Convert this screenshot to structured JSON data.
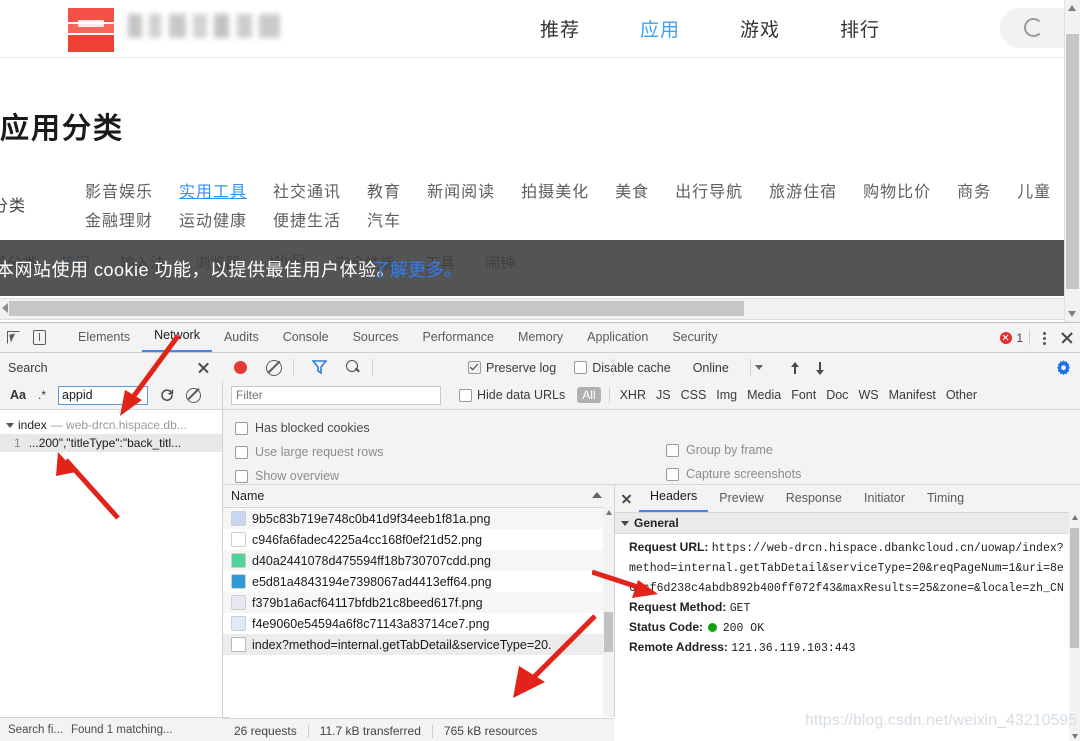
{
  "browser_page": {
    "topnav": {
      "logo_name": "site-logo",
      "brand_blurred": true,
      "links": [
        {
          "label": "推荐",
          "active": false
        },
        {
          "label": "应用",
          "active": true
        },
        {
          "label": "游戏",
          "active": false
        },
        {
          "label": "排行",
          "active": false
        }
      ],
      "search_icon": "search-icon"
    },
    "page_title": "应用分类",
    "category_label": "分类",
    "category_columns": [
      [
        "影音娱乐",
        "金融理财"
      ],
      [
        "实用工具",
        "运动健康"
      ],
      [
        "社交通讯",
        "便捷生活"
      ],
      [
        "教育",
        "汽车"
      ],
      [
        "新闻阅读"
      ],
      [
        "拍摄美化"
      ],
      [
        "美食"
      ],
      [
        "出行导航"
      ],
      [
        "旅游住宿"
      ],
      [
        "购物比价"
      ],
      [
        "商务"
      ],
      [
        "儿童"
      ]
    ],
    "active_category": "实用工具",
    "sub_label": "子分类",
    "sub_items": [
      "热门",
      "输入法",
      "浏览器",
      "Wi-Fi",
      "安全性能",
      "工具",
      "闹钟"
    ],
    "active_sub": "热门",
    "cookie_banner": {
      "text": "本网站使用 cookie 功能，以提供最佳用户体验。",
      "link": "了解更多。"
    }
  },
  "devtools": {
    "tabs": [
      {
        "label": "Elements",
        "active": false
      },
      {
        "label": "Network",
        "active": true
      },
      {
        "label": "Audits",
        "active": false
      },
      {
        "label": "Console",
        "active": false
      },
      {
        "label": "Sources",
        "active": false
      },
      {
        "label": "Performance",
        "active": false
      },
      {
        "label": "Memory",
        "active": false
      },
      {
        "label": "Application",
        "active": false
      },
      {
        "label": "Security",
        "active": false
      }
    ],
    "error_count": "1",
    "icons": {
      "inspect": "inspect-element-icon",
      "device": "device-toolbar-icon",
      "more": "more-options-icon",
      "close": "close-devtools-icon",
      "settings": "gear-icon",
      "record": "record-icon",
      "clear": "clear-icon",
      "filter": "filter-funnel-icon",
      "search": "search-icon",
      "import": "import-har-icon",
      "export": "export-har-icon"
    },
    "toolbar": {
      "search_label": "Search",
      "preserve_log": {
        "label": "Preserve log",
        "checked": true
      },
      "disable_cache": {
        "label": "Disable cache",
        "checked": false
      },
      "throttling": "Online"
    },
    "search_panel": {
      "match_case_label": "Aa",
      "regex_label": ".*",
      "query": "appid",
      "refresh_icon": "refresh-icon",
      "clear_icon": "clear-search-icon",
      "result_file": "index",
      "result_file_url": "— web-drcn.hispace.db...",
      "result_line_number": "1",
      "result_line_text": "...200\",\"titleType\":\"back_titl...",
      "footer_left": "Search fi...",
      "footer_right": "Found 1 matching..."
    },
    "filter_bar": {
      "filter_placeholder": "Filter",
      "hide_data_urls": {
        "label": "Hide data URLs",
        "checked": false
      },
      "type_chips": [
        "All",
        "XHR",
        "JS",
        "CSS",
        "Img",
        "Media",
        "Font",
        "Doc",
        "WS",
        "Manifest",
        "Other"
      ],
      "active_chip": "All"
    },
    "options": [
      {
        "label": "Has blocked cookies",
        "checked": false,
        "dim": false
      },
      {
        "label": "Use large request rows",
        "checked": false,
        "dim": true
      },
      {
        "label": "Show overview",
        "checked": false,
        "dim": true
      },
      {
        "label": "Group by frame",
        "checked": false,
        "dim": true
      },
      {
        "label": "Capture screenshots",
        "checked": false,
        "dim": true
      }
    ],
    "request_list": {
      "column_header": "Name",
      "rows": [
        {
          "name": "9b5c83b719e748c0b41d9f34eeb1f81a.png",
          "icon_color": "#c9d6ef",
          "selected": false
        },
        {
          "name": "c946fa6fadec4225a4cc168f0ef21d52.png",
          "icon_color": "#ffffff",
          "selected": false
        },
        {
          "name": "d40a2441078d475594ff18b730707cdd.png",
          "icon_color": "#4fd39a",
          "selected": false
        },
        {
          "name": "e5d81a4843194e7398067ad4413eff64.png",
          "icon_color": "#2e9ad6",
          "selected": false
        },
        {
          "name": "f379b1a6acf64117bfdb21c8beed617f.png",
          "icon_color": "#e8e8f5",
          "selected": false
        },
        {
          "name": "f4e9060e54594a6f8c71143a83714ce7.png",
          "icon_color": "#dfe9f7",
          "selected": false
        },
        {
          "name": "index?method=internal.getTabDetail&serviceType=20.",
          "icon_color": "#ffffff",
          "selected": true
        }
      ]
    },
    "status_bar": {
      "requests": "26 requests",
      "transferred": "11.7 kB transferred",
      "resources": "765 kB resources"
    },
    "details_pane": {
      "tabs": [
        {
          "label": "Headers",
          "active": true
        },
        {
          "label": "Preview",
          "active": false
        },
        {
          "label": "Response",
          "active": false
        },
        {
          "label": "Initiator",
          "active": false
        },
        {
          "label": "Timing",
          "active": false
        }
      ],
      "section_title": "General",
      "request_url_key": "Request URL:",
      "request_url_value": "https://web-drcn.hispace.dbankcloud.cn/uowap/index?method=internal.getTabDetail&serviceType=20&reqPageNum=1&uri=8e62cf6d238c4abdb892b400ff072f43&maxResults=25&zone=&locale=zh_CN",
      "request_method_key": "Request Method:",
      "request_method_value": "GET",
      "status_code_key": "Status Code:",
      "status_code_value": "200 OK",
      "remote_address_key": "Remote Address:",
      "remote_address_value": "121.36.119.103:443"
    }
  },
  "watermark": "https://blog.csdn.net/weixin_43210595"
}
